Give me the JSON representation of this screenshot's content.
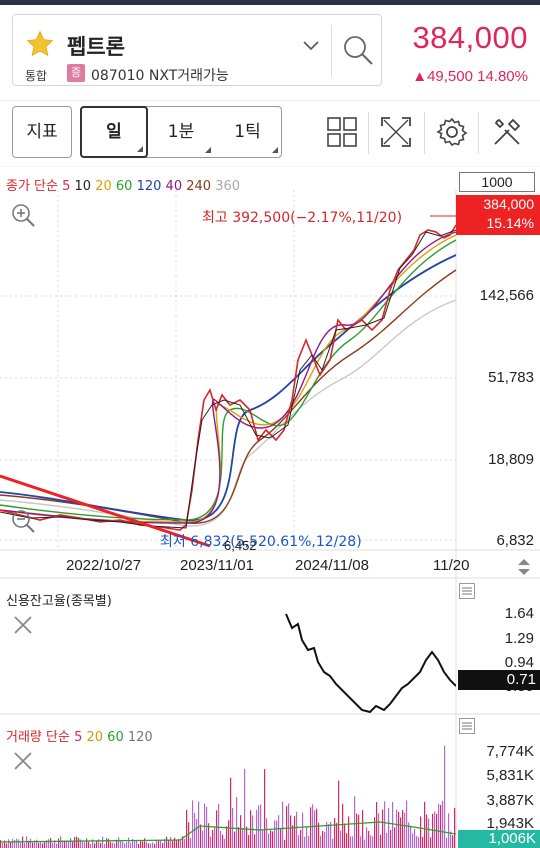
{
  "header": {
    "stock_name": "펩트론",
    "market_tag": "통합",
    "margin_badge": "증",
    "code_line": "087010 NXT거래가능",
    "price": "384,000",
    "change": "▲49,500  14.80%"
  },
  "toolbar": {
    "indicator_label": "지표",
    "period_day": "일",
    "period_min": "1분",
    "period_tick": "1틱"
  },
  "legend": {
    "main_prefix": "종가 단순",
    "main_periods": [
      {
        "label": "5",
        "color": "#e0245e"
      },
      {
        "label": "10",
        "color": "#222222"
      },
      {
        "label": "20",
        "color": "#e0a000"
      },
      {
        "label": "60",
        "color": "#2aa02a"
      },
      {
        "label": "120",
        "color": "#2244aa"
      },
      {
        "label": "40",
        "color": "#8b1a8b"
      },
      {
        "label": "240",
        "color": "#8b3a1a"
      },
      {
        "label": "360",
        "color": "#aaaaaa"
      }
    ],
    "vol_prefix": "거래량 단순",
    "vol_periods": [
      {
        "label": "5",
        "color": "#e0245e"
      },
      {
        "label": "20",
        "color": "#c8a000"
      },
      {
        "label": "60",
        "color": "#2aa02a"
      },
      {
        "label": "120",
        "color": "#777777"
      }
    ]
  },
  "chart": {
    "count_box": "1000",
    "price_tag_value": "384,000",
    "price_tag_pct": "15.14%",
    "high_annotation": "최고 392,500(−2.17%,11/20)",
    "low_annotation": "최저 6,832(5,520.61%,12/28)",
    "low_value": "6,452",
    "y_axis": [
      "142,566",
      "51,783",
      "18,809",
      "6,832"
    ],
    "x_axis": [
      "2022/10/27",
      "2023/11/01",
      "2024/11/08",
      "11/20"
    ]
  },
  "credit_panel": {
    "title": "신용잔고율(종목별)",
    "y_axis": [
      "1.64",
      "1.29",
      "0.94",
      "0.59"
    ],
    "current": "0.71"
  },
  "volume_panel": {
    "y_axis": [
      "7,774K",
      "5,831K",
      "3,887K",
      "1,943K"
    ],
    "current": "1,006K"
  },
  "colors": {
    "up": "#e0245e",
    "trendline": "#ee2222",
    "low_label": "#1b56c6"
  }
}
